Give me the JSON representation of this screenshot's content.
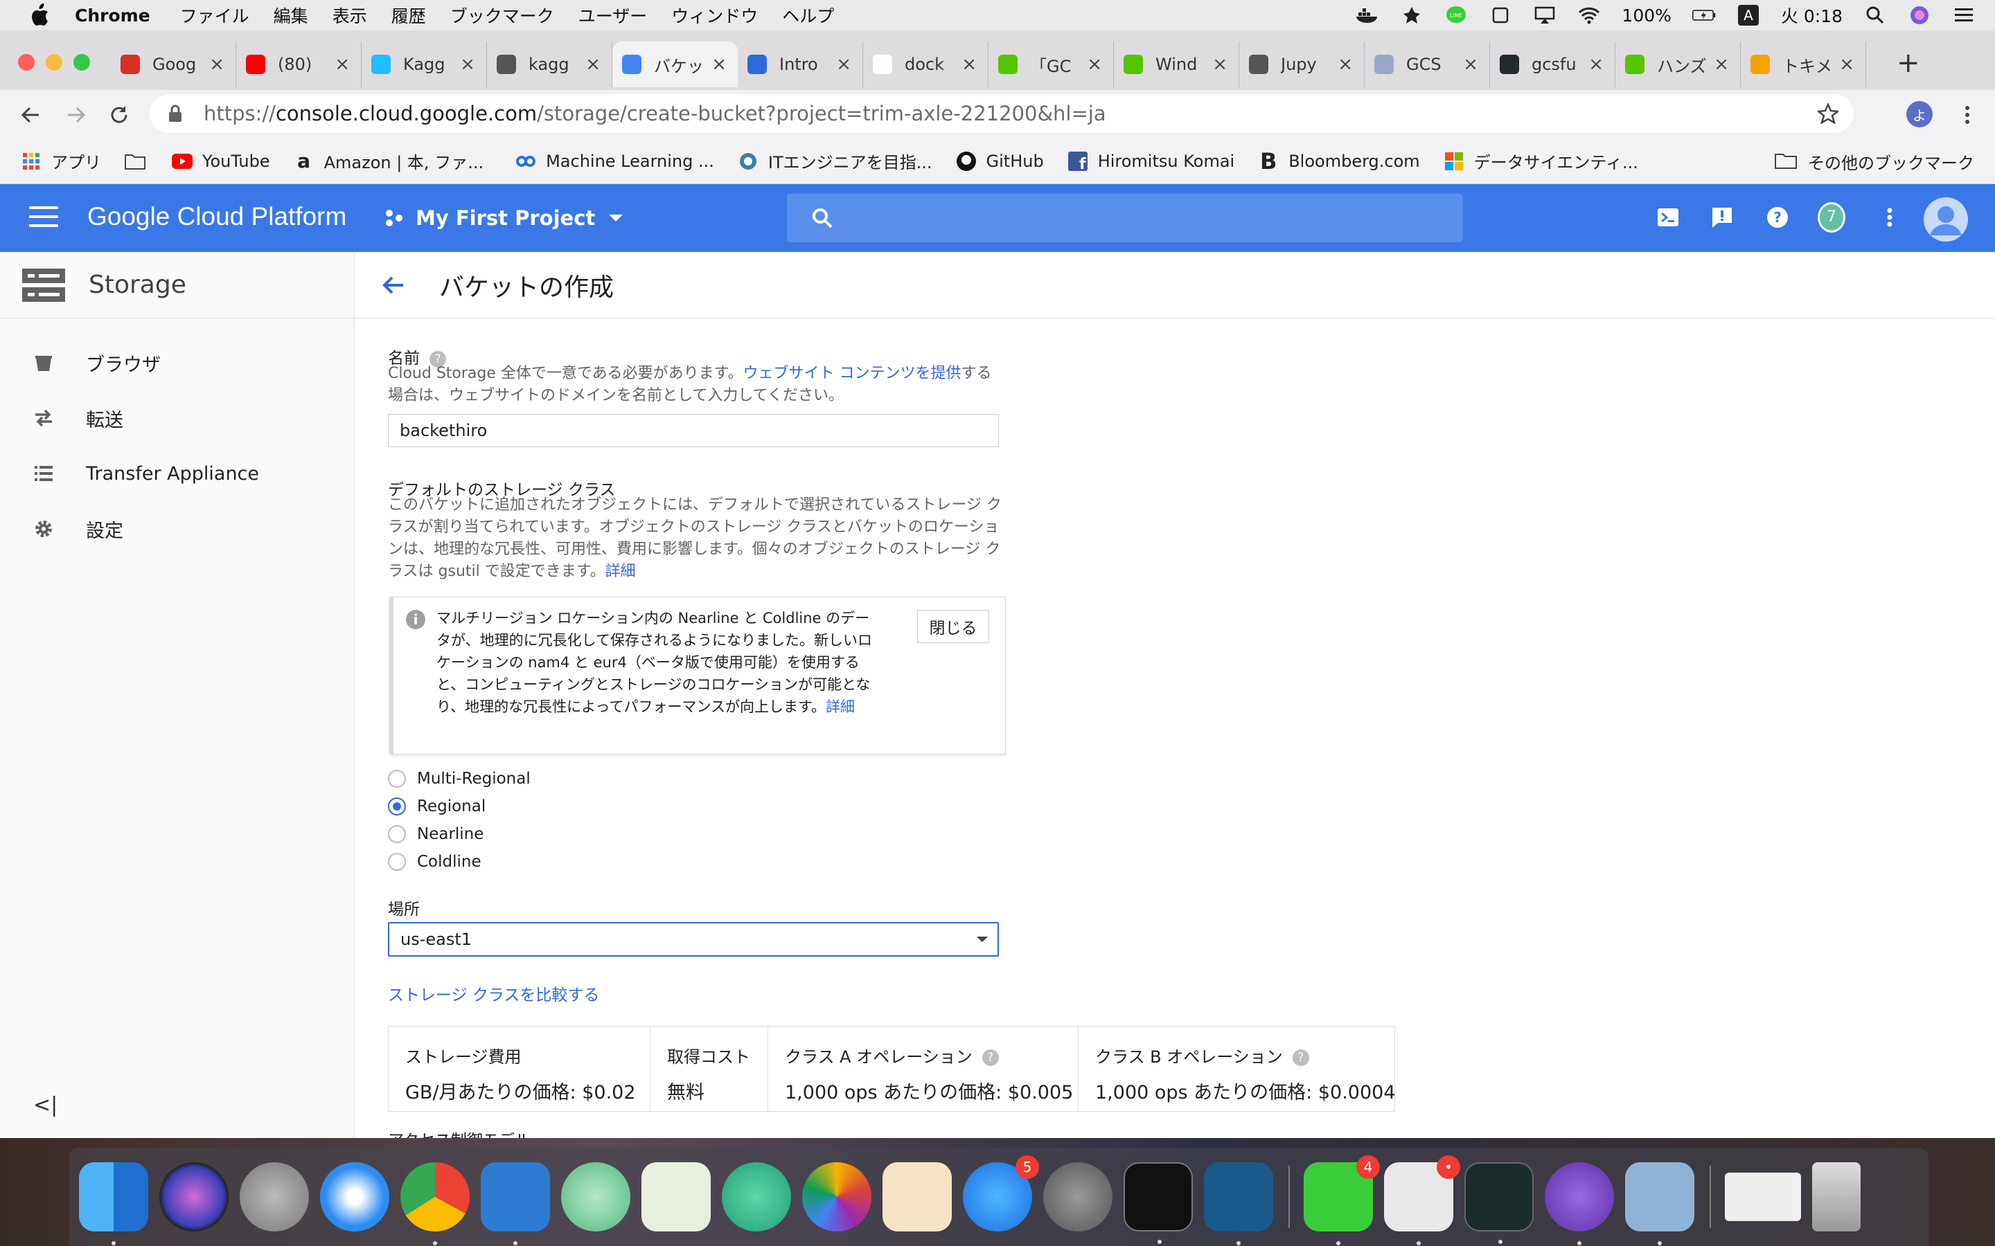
{
  "menubar": {
    "app": "Chrome",
    "items": [
      "ファイル",
      "編集",
      "表示",
      "履歴",
      "ブックマーク",
      "ユーザー",
      "ウィンドウ",
      "ヘルプ"
    ],
    "battery": "100%",
    "clock": "火 0:18",
    "input_mode": "A"
  },
  "tabs": [
    {
      "label": "Goog",
      "color": "#d93025",
      "icon": "google-sheets-icon"
    },
    {
      "label": "(80)",
      "color": "#ff0000",
      "icon": "youtube-icon"
    },
    {
      "label": "Kagg",
      "color": "#20beff",
      "icon": "kaggle-icon"
    },
    {
      "label": "kagg",
      "color": "#555555",
      "icon": "circle-i-icon"
    },
    {
      "label": "バケッ",
      "color": "#4285f4",
      "icon": "storage-icon"
    },
    {
      "label": "Intro",
      "color": "#2a6cd6",
      "icon": "k-icon"
    },
    {
      "label": "dock",
      "color": "#ffffff",
      "icon": "google-icon"
    },
    {
      "label": "「GC",
      "color": "#55c500",
      "icon": "qiita-icon"
    },
    {
      "label": "Wind",
      "color": "#55c500",
      "icon": "qiita-icon"
    },
    {
      "label": "Jupy",
      "color": "#555555",
      "icon": "circle-i-icon"
    },
    {
      "label": "GCS",
      "color": "#9aa7c9",
      "icon": "site-icon"
    },
    {
      "label": "gcsfu",
      "color": "#24292e",
      "icon": "github-icon"
    },
    {
      "label": "ハンズ",
      "color": "#55c500",
      "icon": "qiita-icon"
    },
    {
      "label": "トキメ",
      "color": "#f4a300",
      "icon": "site-icon"
    }
  ],
  "omnibox": {
    "scheme": "https://",
    "host": "console.cloud.google.com",
    "path": "/storage/create-bucket?project=trim-axle-221200&hl=ja",
    "profile_initial": "よ"
  },
  "bookmarks": {
    "items": [
      "アプリ",
      "",
      "YouTube",
      "Amazon | 本, ファ...",
      "Machine Learning ...",
      "ITエンジニアを目指...",
      "GitHub",
      "Hiromitsu Komai",
      "Bloomberg.com",
      "データサイエンティ..."
    ],
    "other": "その他のブックマーク"
  },
  "gcp": {
    "logo": "Google Cloud Platform",
    "project": "My First Project",
    "notifications": "7"
  },
  "nav": {
    "title": "Storage",
    "items": [
      "ブラウザ",
      "転送",
      "Transfer Appliance",
      "設定"
    ],
    "collapse": "<|"
  },
  "page": {
    "title": "バケットの作成",
    "name_label": "名前",
    "name_desc_1": "Cloud Storage 全体で一意である必要があります。",
    "name_desc_link": "ウェブサイト コンテンツを提供",
    "name_desc_2": "する場合は、ウェブサイトのドメインを名前として入力してください。",
    "name_value": "backethiro",
    "storage_class_label": "デフォルトのストレージ クラス",
    "storage_class_desc": "このバケットに追加されたオブジェクトには、デフォルトで選択されているストレージ クラスが割り当てられています。オブジェクトのストレージ クラスとバケットのロケーションは、地理的な冗長性、可用性、費用に影響します。個々のオブジェクトのストレージ クラスは gsutil で設定できます。",
    "storage_class_link": "詳細",
    "notice_text": "マルチリージョン ロケーション内の Nearline と Coldline のデータが、地理的に冗長化して保存されるようになりました。新しいロケーションの nam4 と eur4（ベータ版で使用可能）を使用すると、コンピューティングとストレージのコロケーションが可能となり、地理的な冗長性によってパフォーマンスが向上します。",
    "notice_link": "詳細",
    "notice_close": "閉じる",
    "classes": [
      "Multi-Regional",
      "Regional",
      "Nearline",
      "Coldline"
    ],
    "selected_class": "Regional",
    "location_label": "場所",
    "location_value": "us-east1",
    "compare_link": "ストレージ クラスを比較する",
    "pricing": [
      {
        "head": "ストレージ費用",
        "value": "GB/月あたりの価格: $0.02"
      },
      {
        "head": "取得コスト",
        "value": "無料"
      },
      {
        "head": "クラス A オペレーション",
        "value": "1,000 ops あたりの価格: $0.005"
      },
      {
        "head": "クラス B オペレーション",
        "value": "1,000 ops あたりの価格: $0.0004"
      }
    ],
    "access_label": "アクセス制御モデル"
  },
  "dock": {
    "badges": {
      "app_store": "5",
      "line": "4",
      "slack": "•"
    }
  },
  "colors": {
    "gcp_blue": "#3b78e7",
    "link": "#3367d6"
  }
}
